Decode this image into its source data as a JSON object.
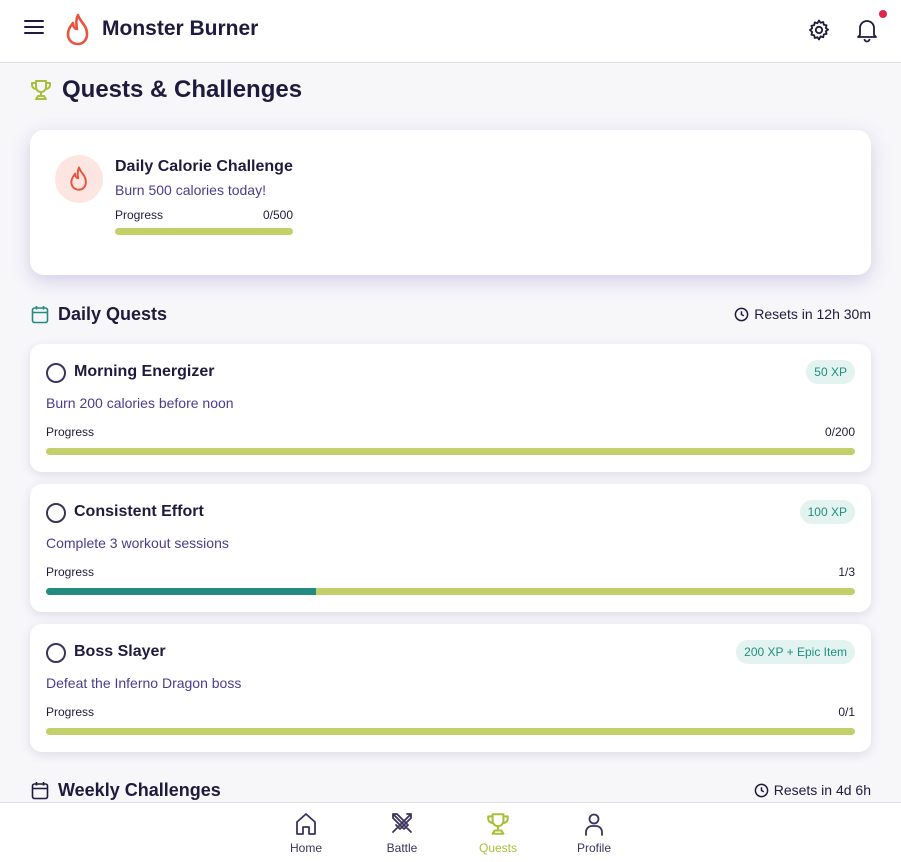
{
  "header": {
    "app_title": "Monster Burner",
    "has_notification": true
  },
  "page": {
    "title": "Quests & Challenges"
  },
  "featured": {
    "title": "Daily Calorie Challenge",
    "description": "Burn 500 calories today!",
    "progress_label": "Progress",
    "progress_value": "0/500",
    "progress_fraction": 0
  },
  "daily": {
    "title": "Daily Quests",
    "reset": "Resets in 12h 30m",
    "quests": [
      {
        "name": "Morning Energizer",
        "reward": "50 XP",
        "description": "Burn 200 calories before noon",
        "progress_label": "Progress",
        "progress_value": "0/200",
        "progress_fraction": 0
      },
      {
        "name": "Consistent Effort",
        "reward": "100 XP",
        "description": "Complete 3 workout sessions",
        "progress_label": "Progress",
        "progress_value": "1/3",
        "progress_fraction": 0.3333
      },
      {
        "name": "Boss Slayer",
        "reward": "200 XP + Epic Item",
        "description": "Defeat the Inferno Dragon boss",
        "progress_label": "Progress",
        "progress_value": "0/1",
        "progress_fraction": 0
      }
    ]
  },
  "weekly": {
    "title": "Weekly Challenges",
    "reset": "Resets in 4d 6h"
  },
  "nav": {
    "items": [
      {
        "label": "Home",
        "icon": "home-icon"
      },
      {
        "label": "Battle",
        "icon": "crossed-swords-icon"
      },
      {
        "label": "Quests",
        "icon": "trophy-icon",
        "active": true
      },
      {
        "label": "Profile",
        "icon": "user-icon"
      }
    ]
  },
  "colors": {
    "accent": "#a9bf3a",
    "progress_track": "#c3d06a",
    "progress_fill": "#238b80",
    "flame": "#e8553f",
    "badge_bg": "#e3f3ef",
    "badge_text": "#1f8f80",
    "notification": "#e0264a"
  }
}
